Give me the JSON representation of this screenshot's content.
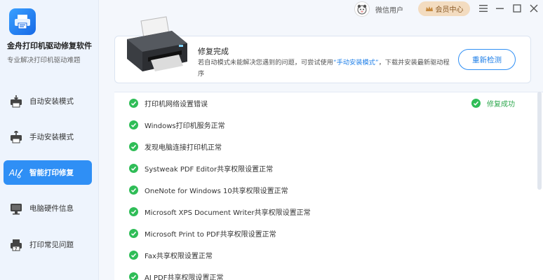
{
  "app": {
    "title": "金舟打印机驱动修复软件",
    "subtitle": "专业解决打印机驱动难题"
  },
  "sidebar": {
    "items": [
      {
        "label": "自动安装模式",
        "icon": "printer-download-icon",
        "active": false
      },
      {
        "label": "手动安装模式",
        "icon": "printer-upload-icon",
        "active": false
      },
      {
        "label": "智能打印修复",
        "icon": "ai-repair-icon",
        "active": true
      },
      {
        "label": "电脑硬件信息",
        "icon": "monitor-icon",
        "active": false
      },
      {
        "label": "打印常见问题",
        "icon": "printer-question-icon",
        "active": false
      }
    ]
  },
  "titlebar": {
    "user_name": "微信用户",
    "vip_label": "会员中心",
    "controls": [
      "menu-icon",
      "minimize-icon",
      "maximize-icon",
      "close-icon"
    ]
  },
  "result": {
    "title": "修复完成",
    "desc_before": "若自动模式未能解决您遇到的问题，可尝试使用",
    "desc_link": "“手动安装模式”",
    "desc_after": "，下载并安装最新驱动程序",
    "recheck_label": "重新检测"
  },
  "checks": {
    "status_label": "修复成功",
    "items": [
      "打印机网络设置错误",
      "Windows打印机服务正常",
      "发现电脑连接打印机正常",
      "Systweak PDF Editor共享权限设置正常",
      "OneNote for Windows 10共享权限设置正常",
      "Microsoft XPS Document Writer共享权限设置正常",
      "Microsoft Print to PDF共享权限设置正常",
      "Fax共享权限设置正常",
      "AI PDF共享权限设置正常"
    ]
  },
  "colors": {
    "accent": "#2f8ff5",
    "success": "#2fbd57",
    "vip": "#f3dcc0"
  }
}
